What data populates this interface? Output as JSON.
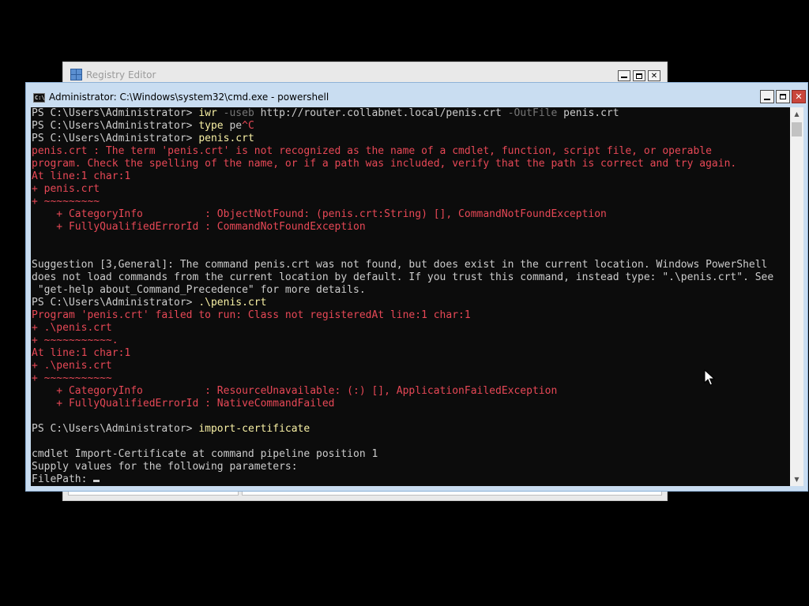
{
  "registry_window": {
    "title": "Registry Editor"
  },
  "console_window": {
    "title": "Administrator: C:\\Windows\\system32\\cmd.exe - powershell",
    "icon_label": "C:\\"
  },
  "console": {
    "lines": [
      [
        [
          "w",
          "PS C:\\Users\\Administrator> "
        ],
        [
          "y",
          "iwr "
        ],
        [
          "g",
          "-useb "
        ],
        [
          "w",
          "http://router.collabnet.local/penis.crt "
        ],
        [
          "g",
          "-OutFile "
        ],
        [
          "w",
          "penis.crt"
        ]
      ],
      [
        [
          "w",
          "PS C:\\Users\\Administrator> "
        ],
        [
          "y",
          "type "
        ],
        [
          "w",
          "pe"
        ],
        [
          "r",
          "^C"
        ]
      ],
      [
        [
          "w",
          "PS C:\\Users\\Administrator> "
        ],
        [
          "y",
          "penis.crt"
        ]
      ],
      [
        [
          "r",
          "penis.crt : The term 'penis.crt' is not recognized as the name of a cmdlet, function, script file, or operable"
        ]
      ],
      [
        [
          "r",
          "program. Check the spelling of the name, or if a path was included, verify that the path is correct and try again."
        ]
      ],
      [
        [
          "r",
          "At line:1 char:1"
        ]
      ],
      [
        [
          "r",
          "+ penis.crt"
        ]
      ],
      [
        [
          "r",
          "+ ~~~~~~~~~"
        ]
      ],
      [
        [
          "r",
          "    + CategoryInfo          : ObjectNotFound: (penis.crt:String) [], CommandNotFoundException"
        ]
      ],
      [
        [
          "r",
          "    + FullyQualifiedErrorId : CommandNotFoundException"
        ]
      ],
      [],
      [],
      [
        [
          "w",
          "Suggestion [3,General]: The command penis.crt was not found, but does exist in the current location. Windows PowerShell"
        ]
      ],
      [
        [
          "w",
          "does not load commands from the current location by default. If you trust this command, instead type: \".\\penis.crt\". See"
        ]
      ],
      [
        [
          "w",
          " \"get-help about_Command_Precedence\" for more details."
        ]
      ],
      [
        [
          "w",
          "PS C:\\Users\\Administrator> "
        ],
        [
          "y",
          ".\\penis.crt"
        ]
      ],
      [
        [
          "r",
          "Program 'penis.crt' failed to run: Class not registeredAt line:1 char:1"
        ]
      ],
      [
        [
          "r",
          "+ .\\penis.crt"
        ]
      ],
      [
        [
          "r",
          "+ ~~~~~~~~~~~."
        ]
      ],
      [
        [
          "r",
          "At line:1 char:1"
        ]
      ],
      [
        [
          "r",
          "+ .\\penis.crt"
        ]
      ],
      [
        [
          "r",
          "+ ~~~~~~~~~~~"
        ]
      ],
      [
        [
          "r",
          "    + CategoryInfo          : ResourceUnavailable: (:) [], ApplicationFailedException"
        ]
      ],
      [
        [
          "r",
          "    + FullyQualifiedErrorId : NativeCommandFailed"
        ]
      ],
      [],
      [
        [
          "w",
          "PS C:\\Users\\Administrator> "
        ],
        [
          "y",
          "import-certificate"
        ]
      ],
      [],
      [
        [
          "w",
          "cmdlet Import-Certificate at command pipeline position 1"
        ]
      ],
      [
        [
          "w",
          "Supply values for the following parameters:"
        ]
      ],
      [
        [
          "w",
          "FilePath: "
        ]
      ]
    ]
  },
  "colors": {
    "console_background": "#0c0c0c",
    "console_text": "#cccccc",
    "command_text": "#f9f1a5",
    "parameter_text": "#767676",
    "error_text": "#e74856"
  }
}
